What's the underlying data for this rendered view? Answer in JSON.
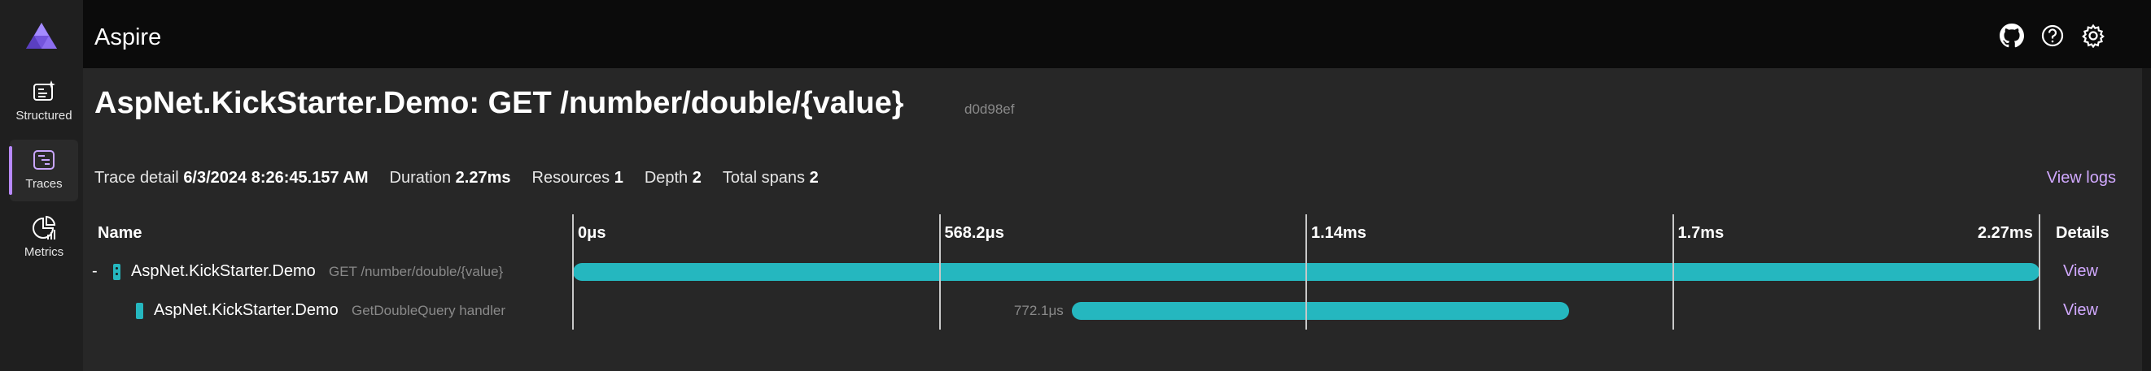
{
  "app": {
    "title": "Aspire"
  },
  "nav": {
    "items": [
      {
        "label": "Structured",
        "icon": "structured-logs-icon",
        "active": false
      },
      {
        "label": "Traces",
        "icon": "traces-icon",
        "active": true
      },
      {
        "label": "Metrics",
        "icon": "metrics-icon",
        "active": false
      }
    ]
  },
  "header_icons": [
    "github-icon",
    "help-icon",
    "settings-icon"
  ],
  "page": {
    "title": "AspNet.KickStarter.Demo: GET /number/double/{value}",
    "trace_id": "d0d98ef"
  },
  "summary": {
    "trace_detail_label": "Trace detail",
    "trace_detail_value": "6/3/2024 8:26:45.157 AM",
    "duration_label": "Duration",
    "duration_value": "2.27ms",
    "resources_label": "Resources",
    "resources_value": "1",
    "depth_label": "Depth",
    "depth_value": "2",
    "total_spans_label": "Total spans",
    "total_spans_value": "2",
    "view_logs": "View logs"
  },
  "table": {
    "name_header": "Name",
    "details_header": "Details",
    "ticks": [
      "0μs",
      "568.2μs",
      "1.14ms",
      "1.7ms",
      "2.27ms"
    ],
    "total_duration_ms": 2.27,
    "spans": [
      {
        "expander": "-",
        "name": "AspNet.KickStarter.Demo",
        "operation": "GET /number/double/{value}",
        "start_ms": 0,
        "duration_ms": 2.27,
        "offset_label": "",
        "view": "View"
      },
      {
        "expander": "",
        "name": "AspNet.KickStarter.Demo",
        "operation": "GetDoubleQuery handler",
        "start_ms": 0.7721,
        "duration_ms": 0.77,
        "offset_label": "772.1μs",
        "view": "View"
      }
    ]
  },
  "colors": {
    "accent": "#b889ff",
    "link": "#d1a9ff",
    "span_bar": "#25b7bf",
    "panel": "#272727",
    "rail": "#1f1f1f"
  }
}
